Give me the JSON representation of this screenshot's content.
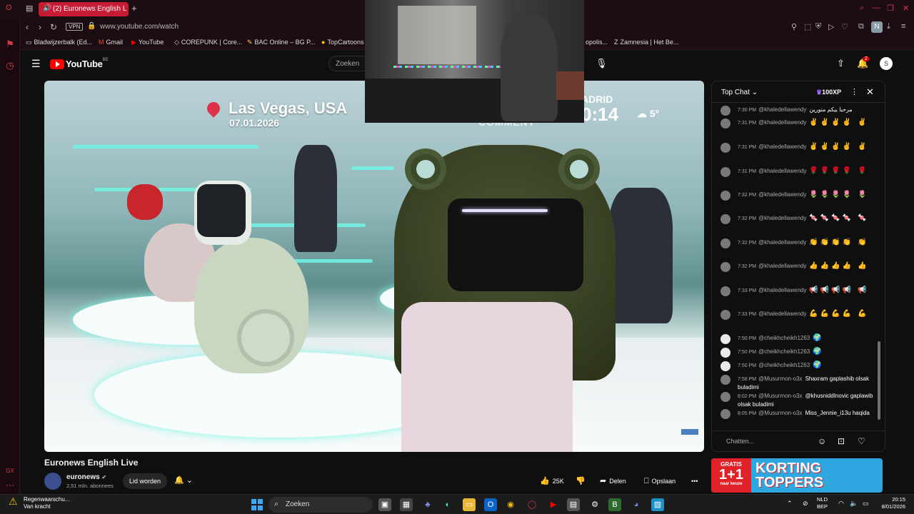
{
  "browser": {
    "tab_title": "(2) Euronews English L",
    "url": "www.youtube.com/watch",
    "vpn_label": "VPN",
    "profile_initial": "N",
    "bookmarks": [
      {
        "icon": "folder-icon",
        "label": "Bladwijzerbalk (Ed..."
      },
      {
        "icon": "gmail-icon",
        "label": "Gmail"
      },
      {
        "icon": "youtube-icon",
        "label": "YouTube"
      },
      {
        "icon": "corepunk-icon",
        "label": "COREPUNK | Core..."
      },
      {
        "icon": "bac-icon",
        "label": "BAC Online – BG P..."
      },
      {
        "icon": "topcartoons-icon",
        "label": "TopCartoons"
      },
      {
        "icon": "zamnesia-icon",
        "label": "Zamnesia | Het Be..."
      }
    ],
    "bookmark_partial": "opolis..."
  },
  "youtube": {
    "logo_text": "YouTube",
    "country_code": "BE",
    "search_placeholder": "Zoeken",
    "notifications_count": "2",
    "avatar_initial": "S"
  },
  "video": {
    "location": "Las Vegas, USA",
    "date": "07.01.2026",
    "city_partial": "ADRID",
    "time_partial": "0:14",
    "temperature": "5°",
    "overlay_text": "COMMENT"
  },
  "video_info": {
    "title": "Euronews English Live",
    "channel": "euronews",
    "subscribers": "2,51 mln. abonnees",
    "join_label": "Lid worden",
    "likes": "25K",
    "share_label": "Delen",
    "save_label": "Opslaan"
  },
  "chat": {
    "header": "Top Chat",
    "xp": "100XP",
    "input_placeholder": "Chatten...",
    "messages": [
      {
        "time": "7:30 PM",
        "user": "@khaledellawendy",
        "text": "مرحبا بيكم متورين"
      },
      {
        "time": "7:31 PM",
        "user": "@khaledellawendy",
        "text": "✌✌✌✌ ✌"
      },
      {
        "time": "7:31 PM",
        "user": "@khaledellawendy",
        "text": "✌✌✌✌ ✌"
      },
      {
        "time": "7:31 PM",
        "user": "@khaledellawendy",
        "text": "🌹🌹🌹🌹 🌹"
      },
      {
        "time": "7:32 PM",
        "user": "@khaledellawendy",
        "text": "🌷🌷🌷🌷 🌷"
      },
      {
        "time": "7:32 PM",
        "user": "@khaledellawendy",
        "text": "🍬🍬🍬🍬 🍬"
      },
      {
        "time": "7:32 PM",
        "user": "@khaledellawendy",
        "text": "👏👏👏👏 👏"
      },
      {
        "time": "7:32 PM",
        "user": "@khaledellawendy",
        "text": "👍👍👍👍 👍"
      },
      {
        "time": "7:33 PM",
        "user": "@khaledellawendy",
        "text": "📢📢📢📢 📢"
      },
      {
        "time": "7:33 PM",
        "user": "@khaledellawendy",
        "text": "💪💪💪💪 💪"
      },
      {
        "time": "7:50 PM",
        "user": "@cheikhcheikh1263",
        "text": "🌍"
      },
      {
        "time": "7:50 PM",
        "user": "@cheikhcheikh1263",
        "text": "🌍"
      },
      {
        "time": "7:50 PM",
        "user": "@cheikhcheikh1263",
        "text": "🌍"
      },
      {
        "time": "7:58 PM",
        "user": "@Musurmon-o3x",
        "text": "Shaxram gaplashib olsak buladimi"
      },
      {
        "time": "8:02 PM",
        "user": "@Musurmon-o3x",
        "text": "@khusniddInovic gaplawib olsak buladimi"
      },
      {
        "time": "8:05 PM",
        "user": "@Musurmon-o3x",
        "text": "Miss_Jennie_i13u haqida"
      }
    ]
  },
  "ad": {
    "badge_top": "GRATIS",
    "badge_big": "1+1",
    "badge_bottom": "naar keuze",
    "line1": "KORTING",
    "line2": "TOPPERS"
  },
  "taskbar": {
    "weather_line1": "Regenwaarschu...",
    "weather_line2": "Van kracht",
    "search_label": "Zoeken",
    "lang_line1": "NLD",
    "lang_line2": "BEP",
    "time": "20:15",
    "date": "8/01/2026"
  },
  "colors": {
    "opera_red": "#c61b33",
    "youtube_red": "#ff0000",
    "background": "#0f0f0f"
  }
}
